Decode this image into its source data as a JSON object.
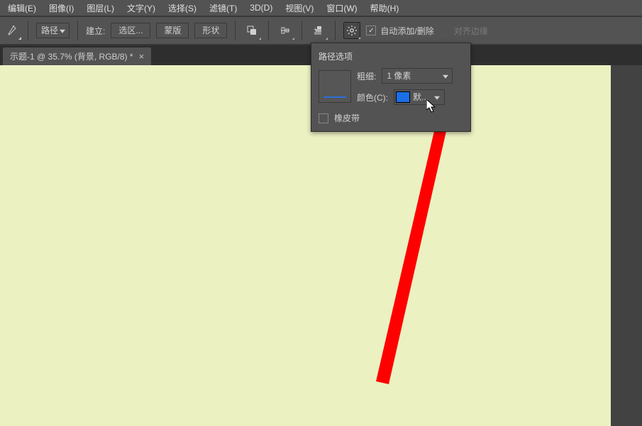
{
  "menubar": {
    "items": [
      "编辑(E)",
      "图像(I)",
      "图层(L)",
      "文字(Y)",
      "选择(S)",
      "滤镜(T)",
      "3D(D)",
      "视图(V)",
      "窗口(W)",
      "帮助(H)"
    ]
  },
  "optionsbar": {
    "tool_mode_value": "路径",
    "build_label": "建立:",
    "buttons": {
      "selection": "选区...",
      "mask": "蒙版",
      "shape": "形状"
    },
    "auto_add_remove": {
      "label": "自动添加/删除",
      "checked": true
    },
    "align_edges": {
      "label": "对齐边缘",
      "checked": false
    }
  },
  "tabbar": {
    "tab_label": "示题-1 @ 35.7% (背景, RGB/8) *"
  },
  "popover": {
    "title": "路径选项",
    "thickness_label": "粗细:",
    "thickness_value": "1 像素",
    "color_label": "颜色(C):",
    "color_value": "默...",
    "color_hex": "#1a6fe6",
    "rubber_band": {
      "label": "橡皮带",
      "checked": false
    }
  }
}
